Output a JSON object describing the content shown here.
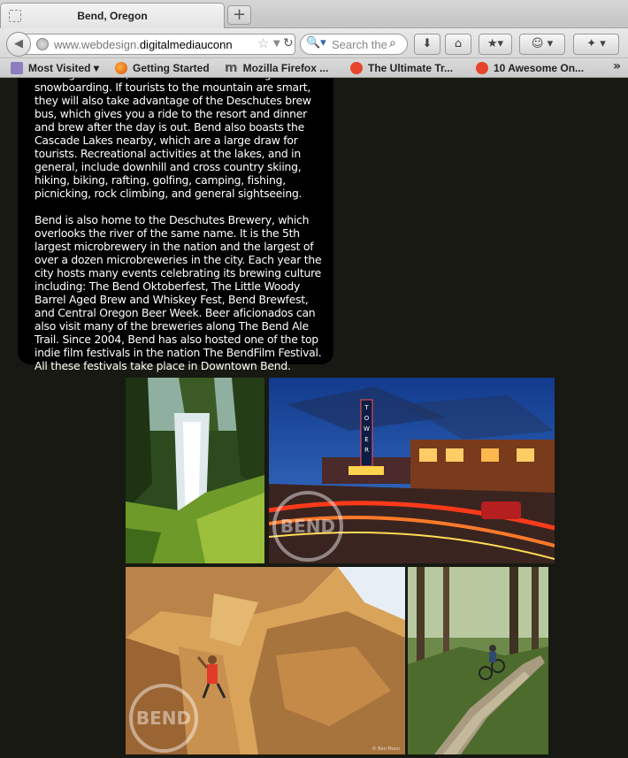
{
  "browser": {
    "tab_title": "Bend, Oregon",
    "new_tab_label": "+",
    "url_prefix": "www.webdesign.",
    "url_domain": "digitalmediauconn",
    "search_placeholder": "Search the",
    "bookmarks": [
      {
        "label": "Most Visited",
        "icon": "folder-icon"
      },
      {
        "label": "Getting Started",
        "icon": "firefox-icon"
      },
      {
        "label": "Mozilla Firefox ...",
        "icon": "mozilla-icon"
      },
      {
        "label": "The Ultimate Tr...",
        "icon": "stumbleupon-icon"
      },
      {
        "label": "10 Awesome On...",
        "icon": "stumbleupon-icon"
      }
    ],
    "bookmarks_overflow": "»"
  },
  "content": {
    "paragraph1": "the edge of Bend, and is renowned for skiing and snowboarding. If tourists to the mountain are smart, they will also take advantage of the Deschutes brew bus, which gives you a ride to the resort and dinner and brew after the day is out. Bend also boasts the Cascade Lakes nearby, which are a large draw for tourists. Recreational activities at the lakes, and in general, include downhill and cross country skiing, hiking, biking, rafting, golfing, camping, fishing, picnicking, rock climbing, and general sightseeing.",
    "paragraph2": "Bend is also home to the Deschutes Brewery, which overlooks the river of the same name. It is the 5th largest microbrewery in the nation and the largest of over a dozen microbreweries in the city. Each year the city hosts many events celebrating its brewing culture including: The Bend Oktoberfest, The Little Woody Barrel Aged Brew and Whiskey Fest, Bend Brewfest, and Central Oregon Beer Week. Beer aficionados can also visit many of the breweries along The Bend Ale Trail. Since 2004, Bend has also hosted one of the top indie film festivals in the nation The BendFilm Festival. All these festivals take place in Downtown Bend."
  },
  "photos": {
    "stamp_text": "BEND",
    "theater_sign": "TOWER",
    "credit": "© Ben Moon"
  },
  "colors": {
    "page_background": "#171912",
    "textbox_background": "#000000",
    "text": "#ffffff"
  }
}
